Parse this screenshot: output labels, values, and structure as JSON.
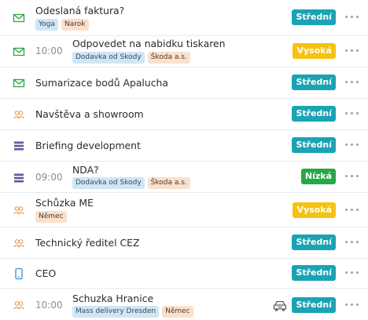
{
  "colors": {
    "stredni": "#1aa3b3",
    "vysoka": "#f5c211",
    "nizka": "#27a847",
    "email_icon": "#27a847",
    "meeting_icon": "#e8a05c",
    "briefing_icon": "#6b4fa3",
    "phone_icon": "#3a8fd1"
  },
  "tasks": [
    {
      "title": "Odeslaná faktura?",
      "time": "",
      "icon": "email-icon",
      "priority": "Střední",
      "priority_color": "#1aa3b3",
      "tags": [
        "Yoga",
        "Narok"
      ]
    },
    {
      "title": "Odpovedet na nabidku tiskaren",
      "time": "10:00",
      "icon": "email-icon",
      "priority": "Vysoká",
      "priority_color": "#f5c211",
      "tags": [
        "Dodavka od Skody",
        "Škoda a.s."
      ]
    },
    {
      "title": "Sumarizace bodů Apalucha",
      "time": "",
      "icon": "email-icon",
      "priority": "Střední",
      "priority_color": "#1aa3b3",
      "tags": []
    },
    {
      "title": "Navštěva a showroom",
      "time": "",
      "icon": "people-icon",
      "priority": "Střední",
      "priority_color": "#1aa3b3",
      "tags": []
    },
    {
      "title": "Briefing development",
      "time": "",
      "icon": "list-icon",
      "priority": "Střední",
      "priority_color": "#1aa3b3",
      "tags": []
    },
    {
      "title": "NDA?",
      "time": "09:00",
      "icon": "list-icon",
      "priority": "Nízká",
      "priority_color": "#27a847",
      "tags": [
        "Dodavka od Skody",
        "Škoda a.s."
      ]
    },
    {
      "title": "Schůzka ME",
      "time": "",
      "icon": "people-icon",
      "priority": "Vysoká",
      "priority_color": "#f5c211",
      "tags": [
        "Němec"
      ]
    },
    {
      "title": "Technický ředitel CEZ",
      "time": "",
      "icon": "people-icon",
      "priority": "Střední",
      "priority_color": "#1aa3b3",
      "tags": []
    },
    {
      "title": "CEO",
      "time": "",
      "icon": "phone-icon",
      "priority": "Střední",
      "priority_color": "#1aa3b3",
      "tags": []
    },
    {
      "title": "Schuzka Hranice",
      "time": "10:00",
      "icon": "people-icon",
      "priority": "Střední",
      "priority_color": "#1aa3b3",
      "tags": [
        "Mass delivery Dresden",
        "Němec"
      ],
      "extra_icon": "car-icon"
    }
  ]
}
